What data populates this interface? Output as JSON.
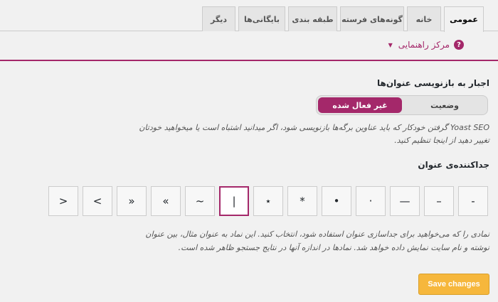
{
  "tabs": [
    "عمومی",
    "خانه",
    "گونه‌های فرسته",
    "طبقه بندی",
    "بایگانی‌ها",
    "دیگر"
  ],
  "help_center": {
    "label": "مرکز راهنمایی",
    "icon": "?"
  },
  "force_rewrite": {
    "heading": "اجبار به بازنویسی عنوان‌ها",
    "options": {
      "disabled": "غیر فعال شده",
      "status": "وضعیت"
    },
    "description_line1": "Yoast SEO گرفتن خودکار که باید عناوین برگه‌ها بازنویسی شود، اگر میدانید اشتباه است یا میخواهید خودتان",
    "description_line2": "تغییر دهید از اینجا تنظیم کنید."
  },
  "separator": {
    "heading": "جداکننده‌ی عنوان",
    "options": [
      "-",
      "–",
      "—",
      "·",
      "•",
      "*",
      "⋆",
      "|",
      "~",
      "«",
      "»",
      "<",
      ">"
    ],
    "selected": "|",
    "description_line1": "نمادی را که می‌خواهید برای جداسازی عنوان استفاده شود، انتخاب کنید. این نماد به عنوان مثال، بین عنوان",
    "description_line2": "نوشته و نام سایت نمایش داده خواهد شد. نمادها در اندازه آنها در نتایج جستجو ظاهر شده است."
  },
  "save_label": "Save changes"
}
